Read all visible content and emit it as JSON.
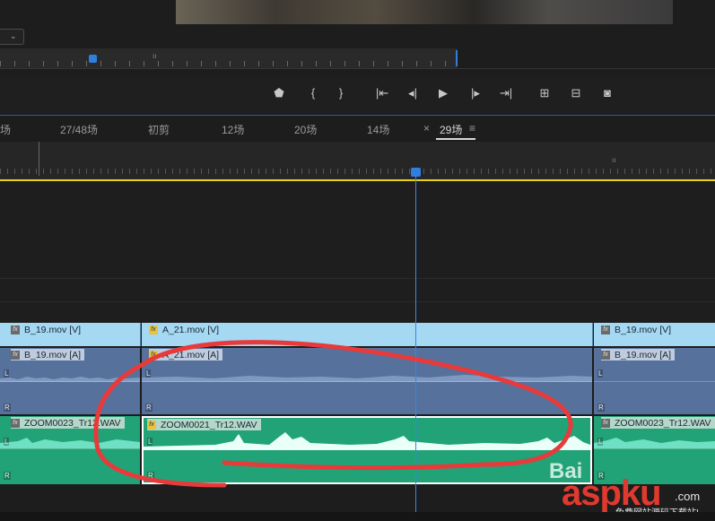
{
  "transport": {
    "buttons": [
      "add-marker",
      "mark-in",
      "mark-out",
      "go-to-in",
      "step-back",
      "play",
      "step-forward",
      "go-to-out",
      "lift",
      "extract",
      "export-frame"
    ]
  },
  "tabs": [
    "场",
    "27/48场",
    "初剪",
    "12场",
    "20场",
    "14场",
    "29场"
  ],
  "active_tab": {
    "close": "×",
    "label": "29场",
    "menu": "≡"
  },
  "clips": {
    "v_b19_left": "B_19.mov [V]",
    "v_a21": "A_21.mov [V]",
    "v_b19_right": "B_19.mov [V]",
    "a_b19_left": "B_19.mov [A]",
    "a_a21": "A_21.mov [A]",
    "a_b19_right": "B_19.mov [A]",
    "z_left": "ZOOM0023_Tr12.WAV",
    "z_mid": "ZOOM0021_Tr12.WAV",
    "z_right": "ZOOM0023_Tr12.WAV",
    "fx": "fx",
    "left_channel": "L",
    "right_channel": "R"
  },
  "watermark": {
    "bai": "Bai",
    "logo": "aspku",
    "com": ".com",
    "sub": "免费网站源码下载站!"
  },
  "colors": {
    "video_clip": "#a4d8f3",
    "audio_clip": "#55719c",
    "zoom_clip": "#22a277",
    "playhead": "#2f7fe0",
    "work_area": "#e8d21a",
    "annotation": "#e83a3a"
  }
}
